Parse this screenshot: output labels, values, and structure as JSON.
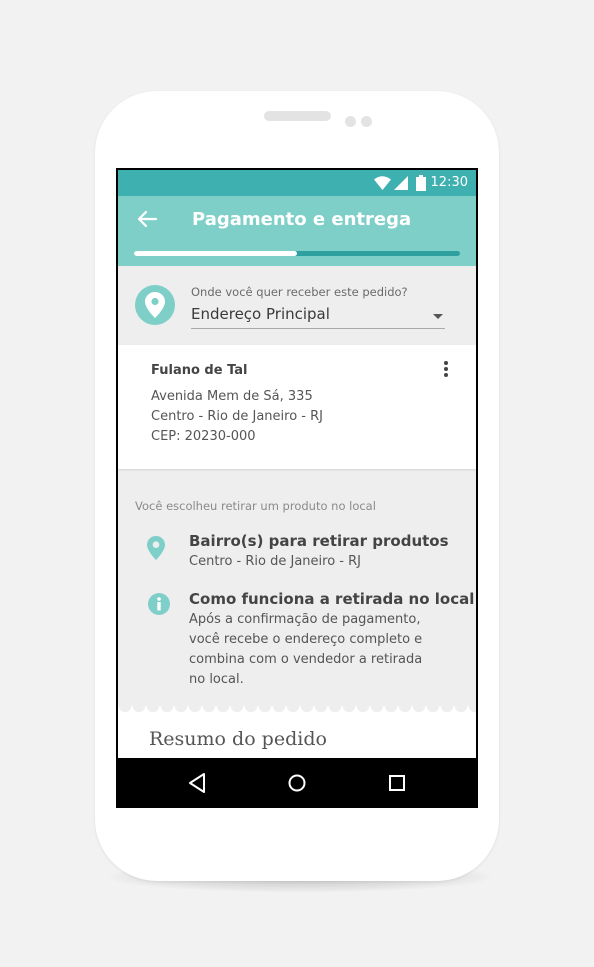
{
  "status_bar": {
    "time": "12:30",
    "icons": [
      "wifi-icon",
      "signal-icon",
      "battery-icon"
    ]
  },
  "app_bar": {
    "title": "Pagamento e entrega",
    "progress_fraction": 0.5
  },
  "delivery": {
    "question": "Onde você quer receber este pedido?",
    "selected_address": "Endereço Principal"
  },
  "address_card": {
    "name": "Fulano de Tal",
    "line1": "Avenida Mem de Sá, 335",
    "line2": "Centro - Rio de Janeiro - RJ",
    "line3": "CEP: 20230-000"
  },
  "pickup": {
    "note": "Você escolheu retirar um produto no local",
    "neighborhoods_title": "Bairro(s) para retirar produtos",
    "neighborhoods_value": "Centro - Rio de Janeiro - RJ",
    "how_title": "Como funciona a retirada no local",
    "how_lines": [
      "Após a confirmação de pagamento,",
      "você recebe o endereço completo e",
      "combina com o vendedor a retirada",
      "no local."
    ]
  },
  "next_section_heading_partial": "Resumo do pedido",
  "colors": {
    "teal": "#7fcfc9",
    "teal_dark": "#3fb0b0",
    "progress_track": "#2ea0a0"
  },
  "nav": {
    "buttons": [
      "back-triangle-icon",
      "home-circle-icon",
      "recents-square-icon"
    ]
  }
}
